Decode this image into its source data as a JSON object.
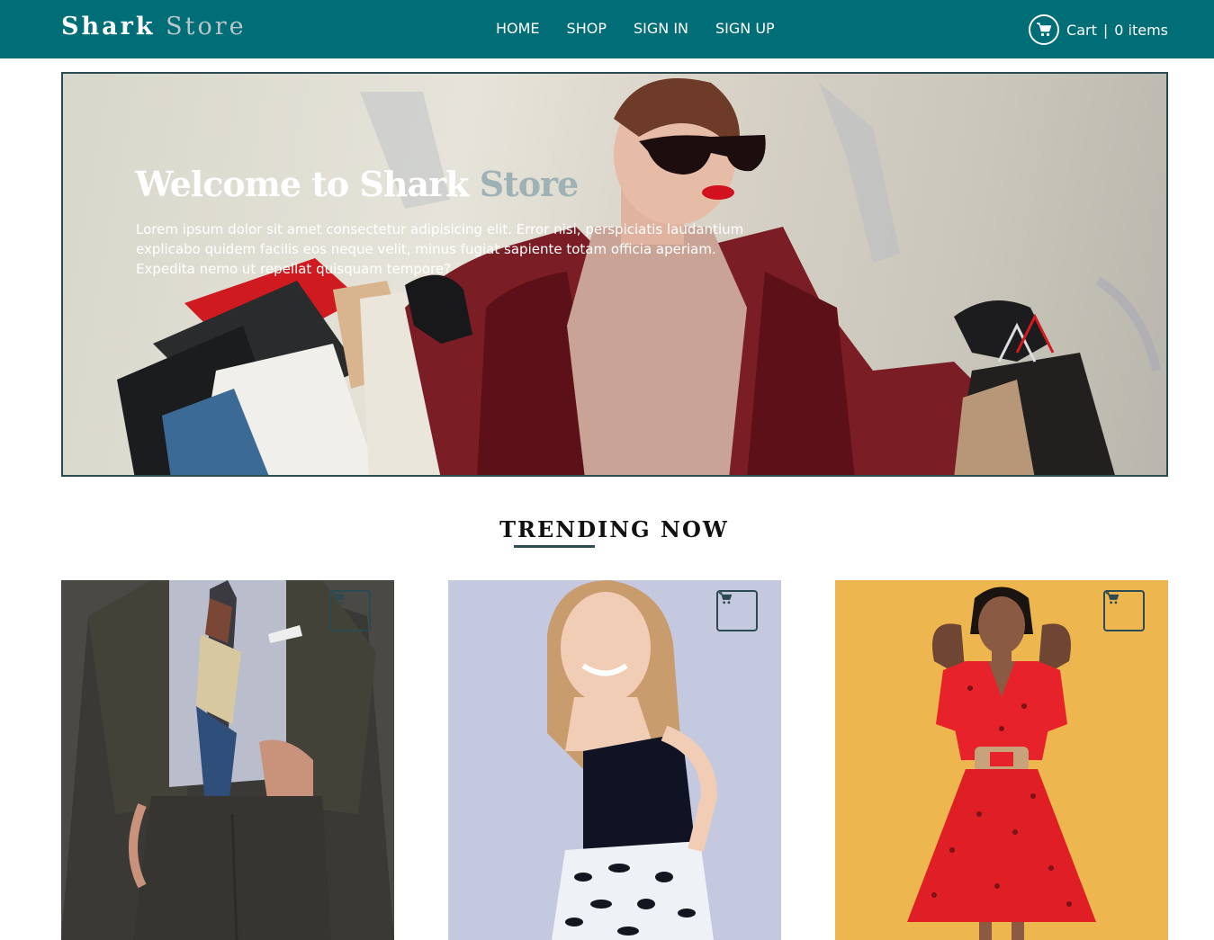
{
  "brand": {
    "part1": "Shark",
    "part2": "Store"
  },
  "nav": {
    "items": [
      {
        "label": "HOME"
      },
      {
        "label": "SHOP"
      },
      {
        "label": "SIGN IN"
      },
      {
        "label": "SIGN UP"
      }
    ]
  },
  "cart": {
    "label": "Cart",
    "separator": "|",
    "count_label": "0 items",
    "icon": "cart-icon"
  },
  "hero": {
    "title_part1": "Welcome to Shark",
    "title_part2": "Store",
    "text": "Lorem ipsum dolor sit amet consectetur adipisicing elit. Error nisi, perspiciatis laudantium explicabo quidem facilis eos neque velit, minus fugiat sapiente totam officia aperiam. Expedita nemo ut repellat quisquam tempore?"
  },
  "trending": {
    "title": "TRENDING NOW",
    "products": [
      {
        "image": "man-in-pinstripe-suit",
        "cart_icon": "cart-icon"
      },
      {
        "image": "smiling-woman-black-top",
        "cart_icon": "cart-icon"
      },
      {
        "image": "woman-in-red-dress",
        "cart_icon": "cart-icon"
      }
    ]
  },
  "colors": {
    "navbar": "#006d77",
    "accent": "#2c4a52",
    "brand_muted": "#b8c7c8"
  }
}
